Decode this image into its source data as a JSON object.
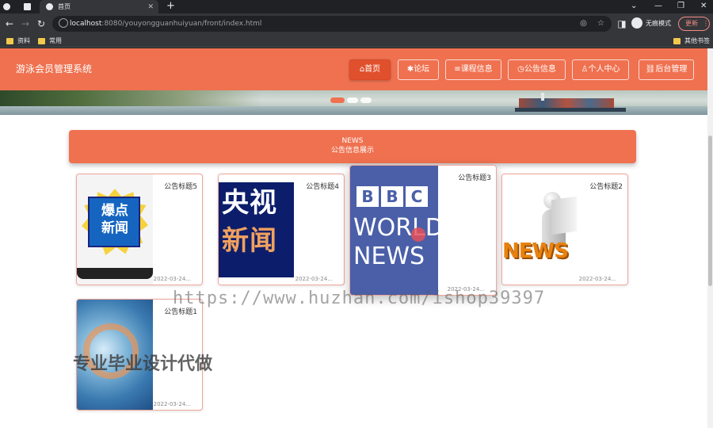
{
  "browser": {
    "tab_title": "首页",
    "tab_icon": "globe-icon",
    "url_host": "localhost",
    "url_path": ":8080/youyongguanhuiyuan/front/index.html",
    "profile_label": "无痕模式",
    "update_label": "更新",
    "bookmarks": [
      "资料",
      "常用"
    ],
    "other_bookmarks": "其他书签"
  },
  "site": {
    "title": "游泳会员管理系统",
    "nav": [
      {
        "label": "首页",
        "icon": "home-icon"
      },
      {
        "label": "论坛",
        "icon": "asterisk-icon"
      },
      {
        "label": "课程信息",
        "icon": "book-icon"
      },
      {
        "label": "公告信息",
        "icon": "clock-icon"
      },
      {
        "label": "个人中心",
        "icon": "user-icon"
      },
      {
        "label": "后台管理",
        "icon": "link-icon"
      }
    ]
  },
  "news_section": {
    "heading_en": "NEWS",
    "heading_cn": "公告信息展示"
  },
  "news": [
    {
      "title": "公告标题5",
      "date": "2022-03-24...",
      "thumb_text": [
        "爆点",
        "新闻"
      ]
    },
    {
      "title": "公告标题4",
      "date": "2022-03-24...",
      "thumb_text": [
        "央视",
        "新闻"
      ]
    },
    {
      "title": "公告标题3",
      "date": "2022-03-24...",
      "thumb_text": [
        "BBC",
        "WORLD",
        "NEWS"
      ]
    },
    {
      "title": "公告标题2",
      "date": "2022-03-24...",
      "thumb_text": [
        "NEWS"
      ]
    },
    {
      "title": "公告标题1",
      "date": "2022-03-24..."
    }
  ],
  "watermarks": {
    "url": "https://www.huzhan.com/ishop39397",
    "cn": "专业毕业设计代做"
  },
  "colors": {
    "brand": "#ef7150",
    "brand_dark": "#e0502d"
  }
}
